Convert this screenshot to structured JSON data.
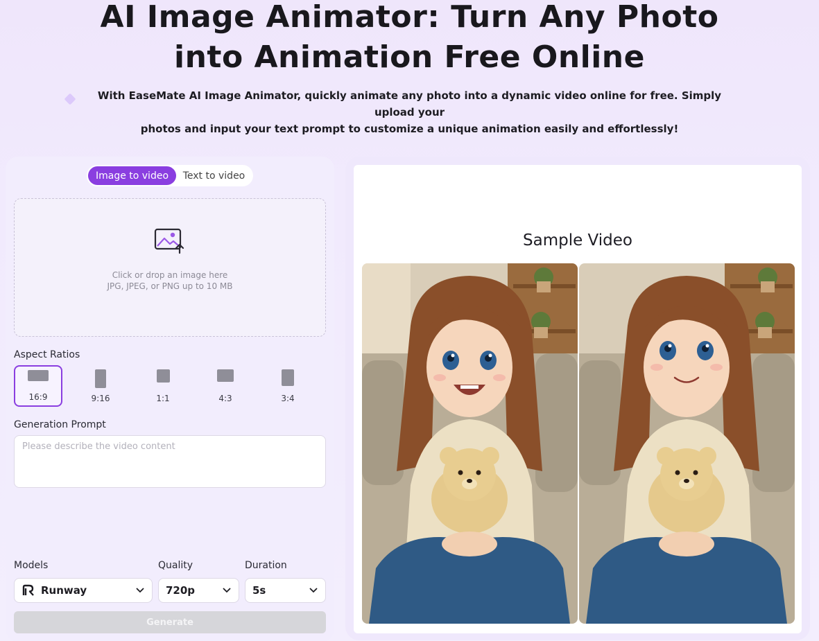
{
  "hero": {
    "title_line1": "AI Image Animator: Turn Any Photo",
    "title_line2": "into Animation Free Online",
    "subtitle_line1": "With EaseMate AI Image Animator, quickly animate any photo into a dynamic video online for free. Simply upload your",
    "subtitle_line2": "photos and input your text prompt to customize a unique animation easily and effortlessly!"
  },
  "mode_toggle": {
    "active": "Image to video",
    "inactive": "Text to video"
  },
  "upload": {
    "icon": "image-upload-icon",
    "line1": "Click or drop an image here",
    "line2": "JPG, JPEG, or PNG up to 10 MB"
  },
  "aspect_ratios": {
    "label": "Aspect Ratios",
    "selected": "16:9",
    "options": [
      "16:9",
      "9:16",
      "1:1",
      "4:3",
      "3:4"
    ]
  },
  "prompt": {
    "label": "Generation Prompt",
    "placeholder": "Please describe the video content",
    "value": ""
  },
  "models": {
    "label": "Models",
    "value": "Runway",
    "icon": "runway-logo-icon"
  },
  "quality": {
    "label": "Quality",
    "value": "720p"
  },
  "duration": {
    "label": "Duration",
    "value": "5s"
  },
  "generate_label": "Generate",
  "sample": {
    "title": "Sample Video"
  },
  "colors": {
    "accent": "#8a3ee0",
    "background": "#efe6fb",
    "generate_disabled": "#d6d6da"
  }
}
